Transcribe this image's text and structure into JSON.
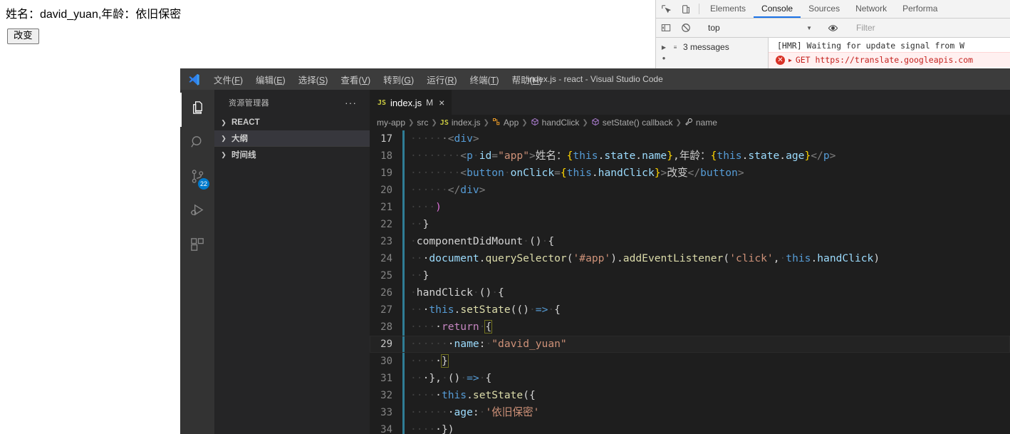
{
  "page": {
    "result_text": "姓名：david_yuan,年龄：依旧保密",
    "change_button": "改变"
  },
  "devtools": {
    "icons": {
      "inspect": "inspect-element-icon",
      "device": "device-toolbar-icon"
    },
    "tabs": [
      {
        "label": "Elements",
        "active": false
      },
      {
        "label": "Console",
        "active": true
      },
      {
        "label": "Sources",
        "active": false
      },
      {
        "label": "Network",
        "active": false
      },
      {
        "label": "Performa",
        "active": false
      }
    ],
    "toolbar": {
      "sidebar_toggle": "console-sidebar-icon",
      "clear": "clear-console-icon",
      "context": "top",
      "eye": "live-expression-icon",
      "filter_placeholder": "Filter"
    },
    "sidebar": {
      "expand": "▶",
      "list_icon": "≡",
      "messages_label": "3 messages"
    },
    "messages": [
      {
        "type": "log",
        "text": "[HMR] Waiting for update signal from W"
      },
      {
        "type": "error",
        "text": "GET https://translate.googleapis.com"
      }
    ]
  },
  "vscode": {
    "window_title": "index.js - react - Visual Studio Code",
    "logo": "vscode-logo-icon",
    "menu": [
      {
        "label": "文件",
        "accel": "F"
      },
      {
        "label": "编辑",
        "accel": "E"
      },
      {
        "label": "选择",
        "accel": "S"
      },
      {
        "label": "查看",
        "accel": "V"
      },
      {
        "label": "转到",
        "accel": "G"
      },
      {
        "label": "运行",
        "accel": "R"
      },
      {
        "label": "终端",
        "accel": "T"
      },
      {
        "label": "帮助",
        "accel": "H"
      }
    ],
    "activity_bar": [
      {
        "name": "explorer",
        "icon": "files-icon",
        "active": true,
        "badge": ""
      },
      {
        "name": "search",
        "icon": "search-icon",
        "active": false,
        "badge": ""
      },
      {
        "name": "source-control",
        "icon": "source-control-icon",
        "active": false,
        "badge": "22"
      },
      {
        "name": "run-and-debug",
        "icon": "run-debug-icon",
        "active": false,
        "badge": ""
      },
      {
        "name": "extensions",
        "icon": "extensions-icon",
        "active": false,
        "badge": ""
      }
    ],
    "sidebar": {
      "title": "资源管理器",
      "more_actions": "···",
      "sections": [
        {
          "label": "REACT",
          "selected": false
        },
        {
          "label": "大纲",
          "selected": true
        },
        {
          "label": "时间线",
          "selected": false
        }
      ]
    },
    "tab": {
      "badge": "JS",
      "name": "index.js",
      "dirty": "M",
      "close": "×"
    },
    "breadcrumb": [
      {
        "label": "my-app",
        "icon": ""
      },
      {
        "label": "src",
        "icon": ""
      },
      {
        "label": "index.js",
        "icon": "js-file-icon"
      },
      {
        "label": "App",
        "icon": "class-icon"
      },
      {
        "label": "handClick",
        "icon": "method-icon"
      },
      {
        "label": "setState() callback",
        "icon": "method-icon"
      },
      {
        "label": "name",
        "icon": "property-icon"
      }
    ],
    "code_lines": [
      {
        "n": "17",
        "current": true,
        "highlight": false
      },
      {
        "n": "18",
        "current": false,
        "highlight": false
      },
      {
        "n": "19",
        "current": false,
        "highlight": false
      },
      {
        "n": "20",
        "current": false,
        "highlight": false
      },
      {
        "n": "21",
        "current": false,
        "highlight": false
      },
      {
        "n": "22",
        "current": false,
        "highlight": false
      },
      {
        "n": "23",
        "current": false,
        "highlight": false
      },
      {
        "n": "24",
        "current": false,
        "highlight": false
      },
      {
        "n": "25",
        "current": false,
        "highlight": false
      },
      {
        "n": "26",
        "current": false,
        "highlight": false
      },
      {
        "n": "27",
        "current": false,
        "highlight": false
      },
      {
        "n": "28",
        "current": false,
        "highlight": false
      },
      {
        "n": "29",
        "current": true,
        "highlight": true
      },
      {
        "n": "30",
        "current": false,
        "highlight": false
      },
      {
        "n": "31",
        "current": false,
        "highlight": false
      },
      {
        "n": "32",
        "current": false,
        "highlight": false
      },
      {
        "n": "33",
        "current": false,
        "highlight": false
      },
      {
        "n": "34",
        "current": false,
        "highlight": false
      }
    ],
    "code_text": [
      "      <div>",
      "        <p id=\"app\">姓名：{this.state.name},年龄：{this.state.age}</p>",
      "        <button onClick={this.handClick}>改变</button>",
      "      </div>",
      "    )",
      "  }",
      "  componentDidMount () {",
      "    document.querySelector('#app').addEventListener('click', this.handClick)",
      "  }",
      "  handClick () {",
      "    this.setState(() => {",
      "      return {",
      "        name: \"david_yuan\"",
      "      }",
      "    }, () => {",
      "      this.setState({",
      "        age: '依旧保密'",
      "      })"
    ]
  }
}
